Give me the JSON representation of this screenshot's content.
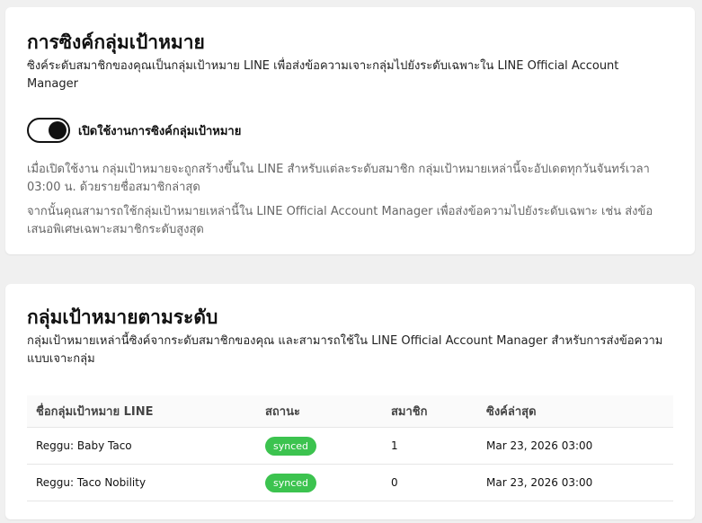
{
  "sync_card": {
    "title": "การซิงค์กลุ่มเป้าหมาย",
    "description": "ซิงค์ระดับสมาชิกของคุณเป็นกลุ่มเป้าหมาย LINE เพื่อส่งข้อความเจาะกลุ่มไปยังระดับเฉพาะใน LINE Official Account Manager",
    "toggle": {
      "label": "เปิดใช้งานการซิงค์กลุ่มเป้าหมาย",
      "enabled": true
    },
    "info_1": "เมื่อเปิดใช้งาน กลุ่มเป้าหมายจะถูกสร้างขึ้นใน LINE สำหรับแต่ละระดับสมาชิก กลุ่มเป้าหมายเหล่านี้จะอัปเดตทุกวันจันทร์เวลา 03:00 น. ด้วยรายชื่อสมาชิกล่าสุด",
    "info_2": "จากนั้นคุณสามารถใช้กลุ่มเป้าหมายเหล่านี้ใน LINE Official Account Manager เพื่อส่งข้อความไปยังระดับเฉพาะ เช่น ส่งข้อเสนอพิเศษเฉพาะสมาชิกระดับสูงสุด"
  },
  "segments_card": {
    "title": "กลุ่มเป้าหมายตามระดับ",
    "description": "กลุ่มเป้าหมายเหล่านี้ซิงค์จากระดับสมาชิกของคุณ และสามารถใช้ใน LINE Official Account Manager สำหรับการส่งข้อความแบบเจาะกลุ่ม",
    "table": {
      "headers": {
        "name": "ชื่อกลุ่มเป้าหมาย LINE",
        "status": "สถานะ",
        "members": "สมาชิก",
        "last_sync": "ซิงค์ล่าสุด"
      },
      "rows": [
        {
          "name": "Reggu: Baby Taco",
          "status": "synced",
          "members": "1",
          "last_sync": "Mar 23, 2026 03:00"
        },
        {
          "name": "Reggu: Taco Nobility",
          "status": "synced",
          "members": "0",
          "last_sync": "Mar 23, 2026 03:00"
        }
      ]
    }
  },
  "colors": {
    "synced_badge": "#3cc34f",
    "background": "#f0f0f0",
    "card": "#ffffff"
  }
}
